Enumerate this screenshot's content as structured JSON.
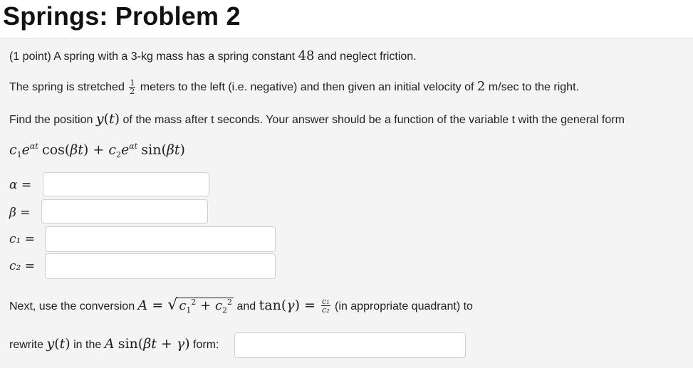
{
  "page_title": "Springs: Problem 2",
  "problem": {
    "intro": "(1 point) A spring with a 3-kg mass has a spring constant ",
    "spring_constant": "48",
    "intro_tail": " and neglect friction.",
    "stretch_pre": "The spring is stretched ",
    "stretch_frac_num": "1",
    "stretch_frac_den": "2",
    "stretch_post": " meters to the left (i.e. negative) and then given an initial velocity of ",
    "velocity": "2",
    "velocity_post": " m/sec to the right.",
    "find_pre": "Find the position ",
    "find_post": " of the mass after t seconds. Your answer should be a function of the variable t with the general form"
  },
  "fields": [
    {
      "label": "α =",
      "value": ""
    },
    {
      "label": "β =",
      "value": ""
    },
    {
      "label": "c₁ =",
      "value": ""
    },
    {
      "label": "c₂ =",
      "value": ""
    }
  ],
  "conversion": {
    "pre": "Next, use the conversion ",
    "and": " and ",
    "post": " (in appropriate quadrant) to"
  },
  "rewrite": {
    "pre": "rewrite ",
    "mid": " in the ",
    "post": " form:",
    "value": ""
  }
}
